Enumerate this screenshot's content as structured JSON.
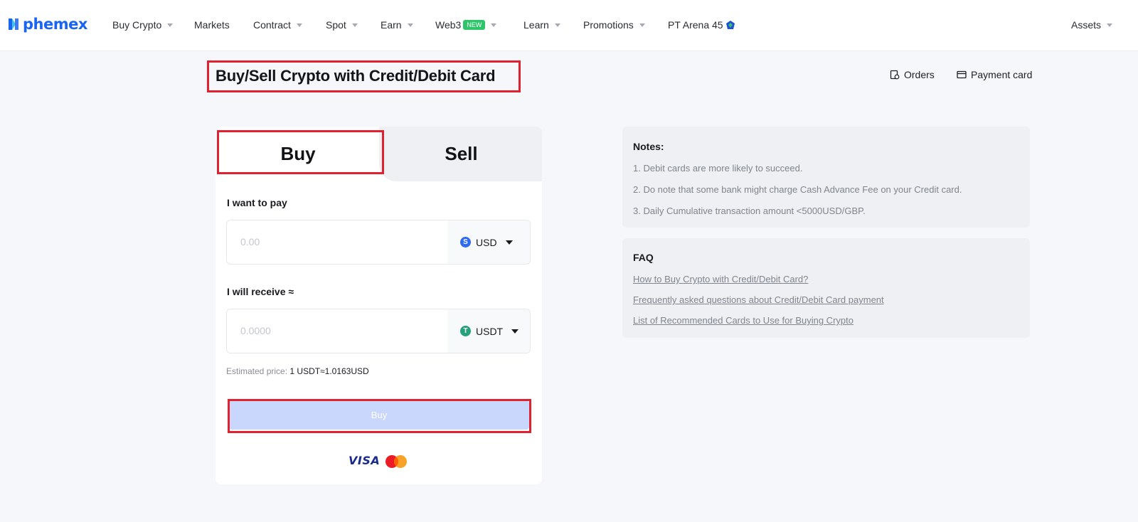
{
  "nav": {
    "brand": "phemex",
    "items": [
      {
        "label": "Buy Crypto",
        "caret": true
      },
      {
        "label": "Markets",
        "caret": false
      },
      {
        "label": "Contract",
        "caret": true
      },
      {
        "label": "Spot",
        "caret": true
      },
      {
        "label": "Earn",
        "caret": true
      },
      {
        "label": "Web3",
        "badge": "NEW",
        "caret": true
      },
      {
        "label": "Learn",
        "caret": true
      },
      {
        "label": "Promotions",
        "caret": true
      },
      {
        "label": "PT Arena 45"
      }
    ],
    "assets": "Assets"
  },
  "header": {
    "title": "Buy/Sell Crypto with Credit/Debit Card",
    "orders": "Orders",
    "payment_card": "Payment card"
  },
  "trade": {
    "tab_buy": "Buy",
    "tab_sell": "Sell",
    "pay_label": "I want to pay",
    "pay_placeholder": "0.00",
    "pay_currency": "USD",
    "pay_coin_symbol": "S",
    "receive_label": "I will receive ≈",
    "receive_placeholder": "0.0000",
    "receive_currency": "USDT",
    "receive_coin_symbol": "T",
    "estimate_label": "Estimated price:",
    "estimate_value": "1 USDT≈1.0163USD",
    "buy_button": "Buy",
    "visa": "VISA"
  },
  "notes": {
    "title": "Notes:",
    "items": [
      "1. Debit cards are more likely to succeed.",
      "2. Do note that some bank might charge Cash Advance Fee on your Credit card.",
      "3. Daily Cumulative transaction amount <5000USD/GBP."
    ]
  },
  "faq": {
    "title": "FAQ",
    "links": [
      "How to Buy Crypto with Credit/Debit Card?",
      "Frequently asked questions about Credit/Debit Card payment",
      "List of Recommended Cards to Use for Buying Crypto"
    ]
  },
  "colors": {
    "brand": "#1a64f2",
    "highlight": "#e0212f",
    "usd_coin": "#2f6bf2",
    "usdt_coin": "#26a17b",
    "new_badge": "#2ec46a"
  }
}
